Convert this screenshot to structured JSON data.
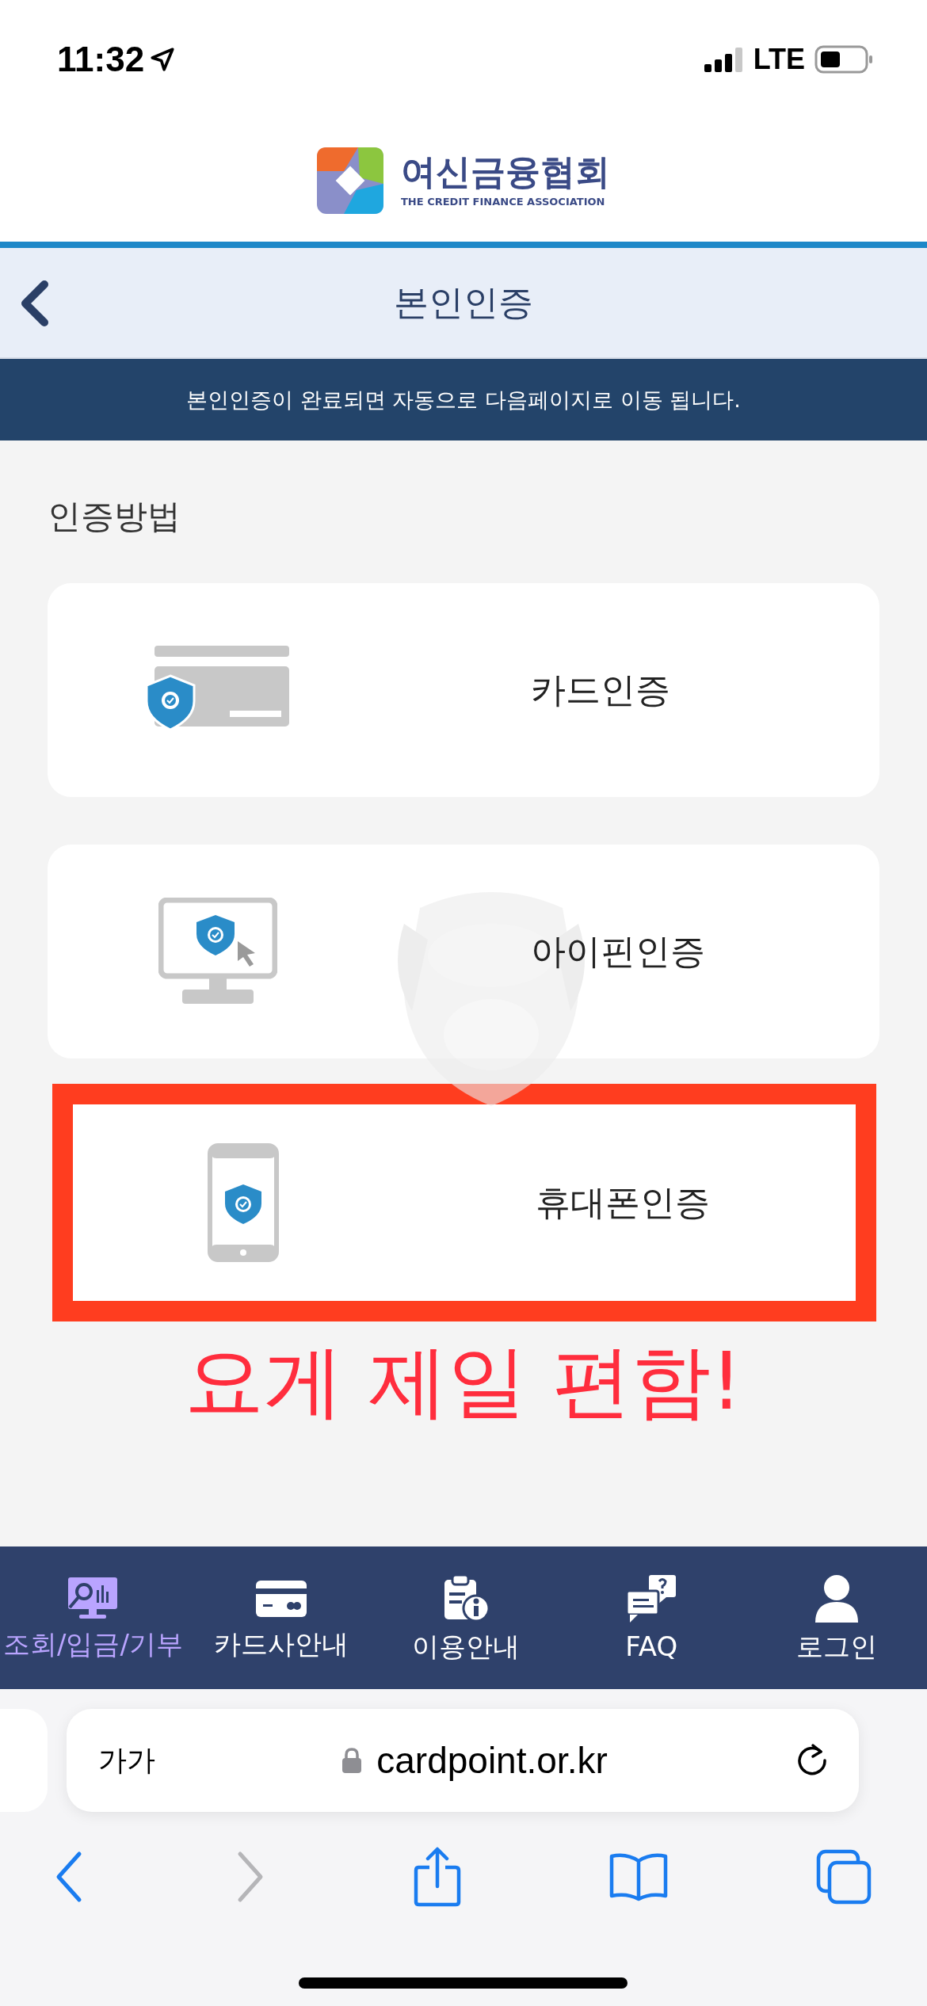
{
  "status_bar": {
    "time": "11:32",
    "network": "LTE"
  },
  "logo": {
    "name": "여신금융협회",
    "subtitle": "THE CREDIT FINANCE ASSOCIATION"
  },
  "header": {
    "title": "본인인증"
  },
  "notice": "본인인증이 완료되면 자동으로 다음페이지로 이동 됩니다.",
  "section_title": "인증방법",
  "methods": [
    {
      "kind": "card",
      "label": "카드인증",
      "highlighted": false
    },
    {
      "kind": "ipin",
      "label": "아이핀인증",
      "highlighted": false
    },
    {
      "kind": "phone",
      "label": "휴대폰인증",
      "highlighted": true
    }
  ],
  "annotation": "요게 제일 편함!",
  "bottom_nav": [
    {
      "kind": "lookup",
      "label": "조회/입금/기부",
      "selected": true
    },
    {
      "kind": "cards",
      "label": "카드사안내",
      "selected": false
    },
    {
      "kind": "guide",
      "label": "이용안내",
      "selected": false
    },
    {
      "kind": "faq",
      "label": "FAQ",
      "selected": false
    },
    {
      "kind": "login",
      "label": "로그인",
      "selected": false
    }
  ],
  "browser": {
    "text_size": "가가",
    "url": "cardpoint.or.kr"
  },
  "toolbar": [
    {
      "kind": "back",
      "disabled": false
    },
    {
      "kind": "forward",
      "disabled": true
    },
    {
      "kind": "share",
      "disabled": false
    },
    {
      "kind": "bookmarks",
      "disabled": false
    },
    {
      "kind": "tabs",
      "disabled": false
    }
  ]
}
